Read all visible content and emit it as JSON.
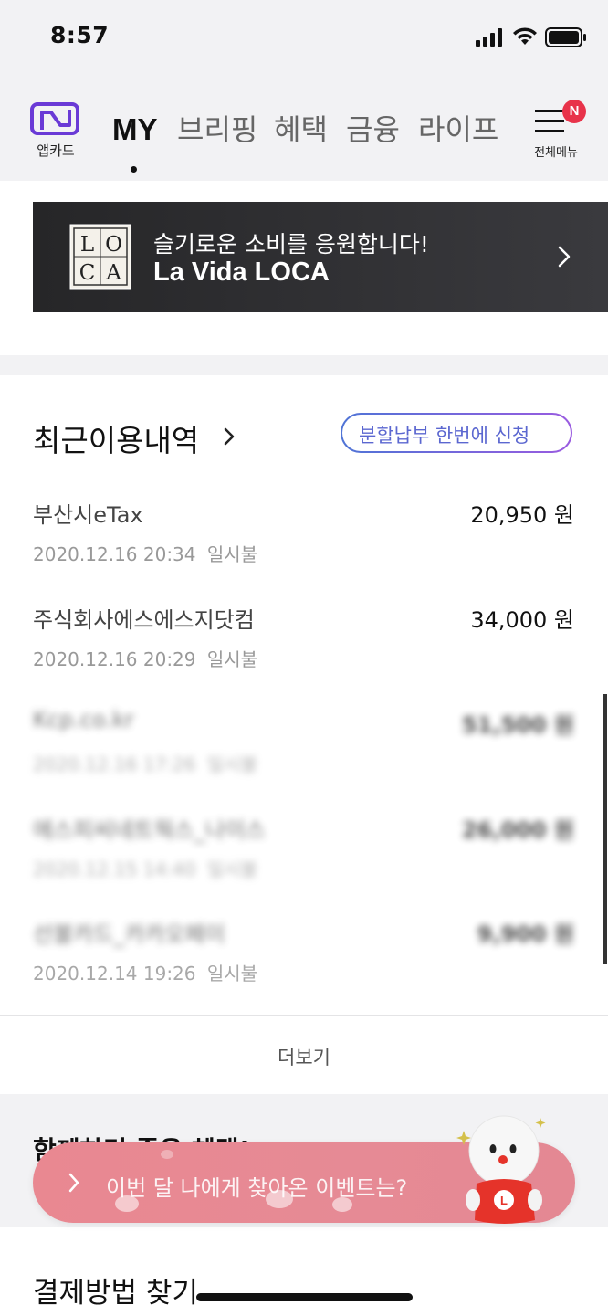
{
  "status_bar": {
    "time": "8:57"
  },
  "header": {
    "app_label": "앱카드",
    "tabs": [
      {
        "label": "MY",
        "active": true
      },
      {
        "label": "브리핑",
        "active": false
      },
      {
        "label": "혜택",
        "active": false
      },
      {
        "label": "금융",
        "active": false
      },
      {
        "label": "라이프",
        "active": false
      }
    ],
    "menu_label": "전체메뉴",
    "menu_badge": "N"
  },
  "banner": {
    "logo_letters": [
      "L",
      "O",
      "C",
      "A"
    ],
    "line1": "슬기로운 소비를 응원합니다!",
    "line2": "La Vida LOCA"
  },
  "recent": {
    "title": "최근이용내역",
    "installment_button": "분할납부 한번에 신청",
    "transactions": [
      {
        "merchant": "부산시eTax",
        "amount": "20,950 원",
        "datetime": "2020.12.16 20:34",
        "type": "일시불"
      },
      {
        "merchant": "주식회사에스에스지닷컴",
        "amount": "34,000 원",
        "datetime": "2020.12.16 20:29",
        "type": "일시불"
      },
      {
        "merchant": "Kcp.co.kr",
        "amount": "51,500 원",
        "datetime": "2020.12.16 17:26",
        "type": "일시불"
      },
      {
        "merchant": "에스피씨네트웍스_나이스",
        "amount": "26,000 원",
        "datetime": "2020.12.15 14:40",
        "type": "일시불"
      },
      {
        "merchant": "선불카드_카카오페이",
        "amount": "9,900 원",
        "datetime": "2020.12.14 19:26",
        "type": "일시불"
      }
    ],
    "more_label": "더보기"
  },
  "partner": {
    "title": "함께하면 좋은 혜택!"
  },
  "event": {
    "label": "이번 달 나에게 찾아온 이벤트는?"
  },
  "payment": {
    "title": "결제방법 찾기"
  },
  "colors": {
    "accent_purple": "#6a3ad6",
    "badge_red": "#e8334a",
    "event_pink": "#e98891"
  }
}
